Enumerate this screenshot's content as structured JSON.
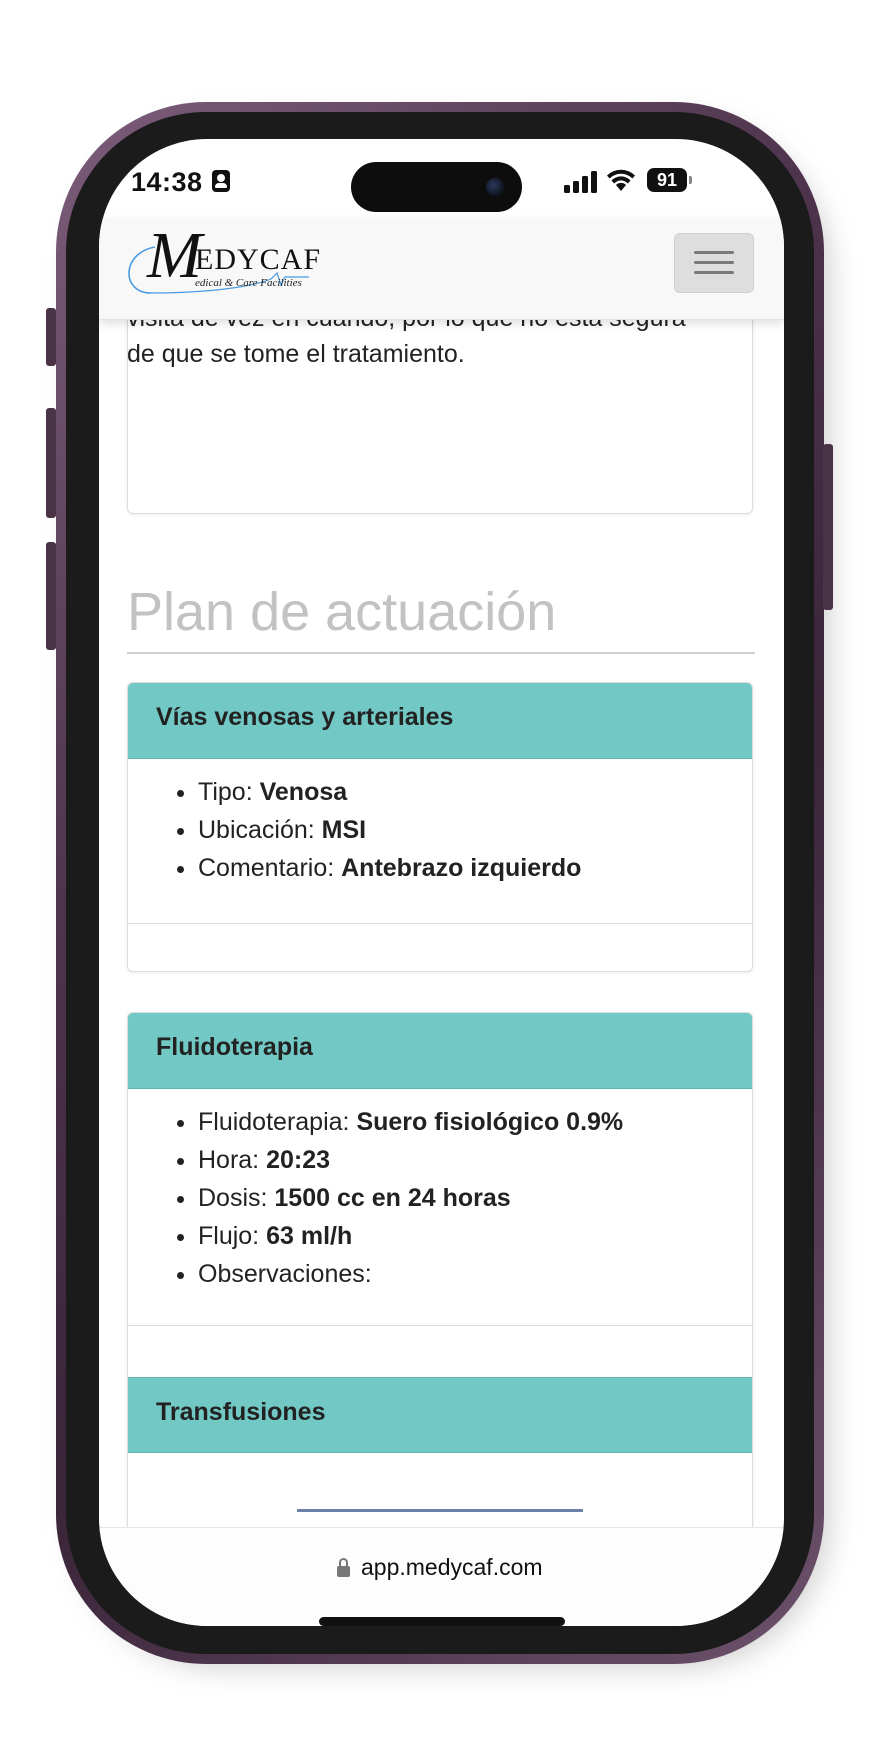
{
  "status_bar": {
    "time": "14:38",
    "battery": "91",
    "icons": [
      "contact-card-icon",
      "signal-icon",
      "wifi-icon",
      "battery-icon"
    ]
  },
  "navbar": {
    "logo_initial": "M",
    "logo_rest": "EDYCAF",
    "logo_subtitle": "edical & Care Facilities",
    "menu_icon": "hamburger-menu-icon"
  },
  "previous_card": {
    "text": "visita de vez en cuando, por lo que no está segura de que se tome el tratamiento."
  },
  "section": {
    "title": "Plan de actuación"
  },
  "vias_card": {
    "title": "Vías venosas y arteriales",
    "items": [
      {
        "label": "Tipo: ",
        "value": "Venosa"
      },
      {
        "label": "Ubicación: ",
        "value": "MSI"
      },
      {
        "label": "Comentario: ",
        "value": "Antebrazo izquierdo"
      }
    ]
  },
  "fluido_card": {
    "title": "Fluidoterapia",
    "items": [
      {
        "label": "Fluidoterapia: ",
        "value": "Suero fisiológico 0.9%"
      },
      {
        "label": "Hora: ",
        "value": "20:23"
      },
      {
        "label": "Dosis: ",
        "value": "1500 cc en 24 horas"
      },
      {
        "label": "Flujo: ",
        "value": "63 ml/h"
      },
      {
        "label": "Observaciones: ",
        "value": ""
      }
    ]
  },
  "transfusiones_card": {
    "title": "Transfusiones"
  },
  "address_bar": {
    "url": "app.medycaf.com",
    "lock_icon": "lock-icon"
  },
  "colors": {
    "card_header": "#71c8c4",
    "section_title": "#c2c2c2",
    "phone_frame": "#4e344c",
    "underline": "#6d82a9"
  }
}
